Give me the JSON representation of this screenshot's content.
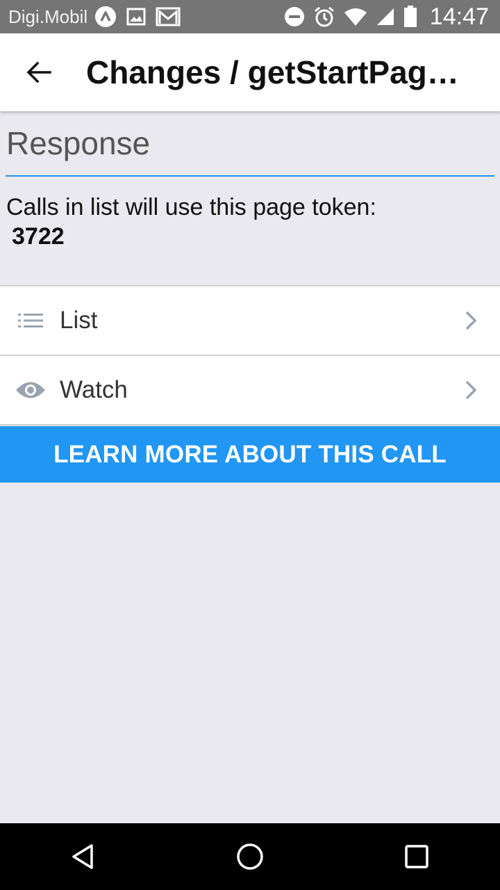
{
  "status_bar": {
    "carrier": "Digi.Mobil",
    "time": "14:47",
    "icons": [
      "notification-a-icon",
      "image-icon",
      "gmail-icon",
      "dnd-icon",
      "alarm-icon",
      "wifi-icon",
      "signal-icon",
      "battery-icon"
    ]
  },
  "app_bar": {
    "back_icon": "arrow-left-icon",
    "title": "Changes / getStartPageToken"
  },
  "response": {
    "heading": "Response",
    "token_label": "Calls in list will use this page token:",
    "token_value": "3722"
  },
  "actions": [
    {
      "label": "List",
      "icon": "list-icon"
    },
    {
      "label": "Watch",
      "icon": "eye-icon"
    }
  ],
  "learn_more_label": "LEARN MORE ABOUT THIS CALL",
  "colors": {
    "accent": "#2196f3",
    "status_bar": "#757575",
    "background": "#e9e9ef"
  },
  "nav_bar": {
    "icons": [
      "back-triangle-icon",
      "home-circle-icon",
      "recents-square-icon"
    ]
  }
}
